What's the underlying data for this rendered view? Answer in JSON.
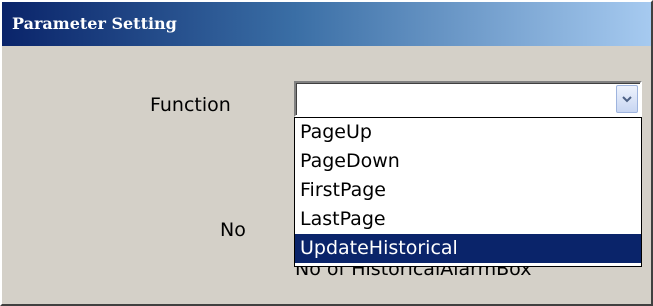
{
  "window": {
    "title": "Parameter Setting"
  },
  "form": {
    "function_label": "Function",
    "function_value": "",
    "no_label": "No",
    "obscured_text": "No of HistoricalAlarmBox"
  },
  "dropdown": {
    "options": [
      "PageUp",
      "PageDown",
      "FirstPage",
      "LastPage",
      "UpdateHistorical"
    ],
    "highlighted_option": "UpdateHistorical"
  },
  "colors": {
    "titlebar_start": "#0a246a",
    "titlebar_end": "#a6caf0",
    "dialog_bg": "#d4d0c8",
    "selection_bg": "#0a246a",
    "selection_text": "#ffffff"
  },
  "icons": {
    "combo_button": "chevron-down-icon"
  }
}
